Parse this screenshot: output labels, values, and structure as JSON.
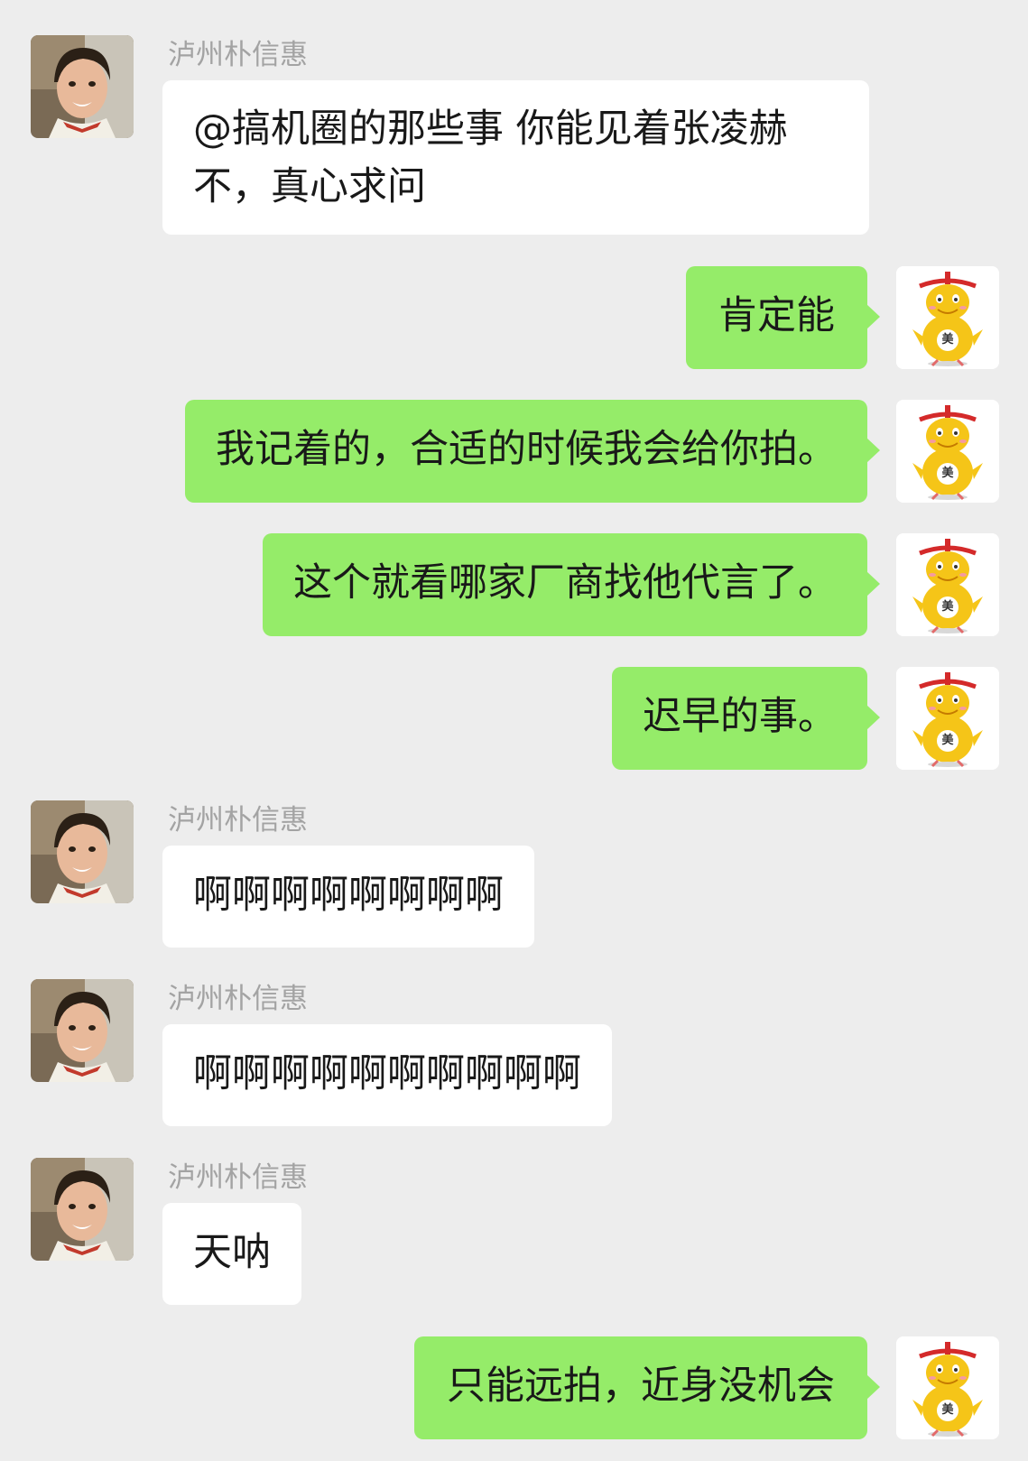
{
  "contact": {
    "name": "泸州朴信惠"
  },
  "messages": [
    {
      "from": "them",
      "sender": "泸州朴信惠",
      "text": "@搞机圈的那些事  你能见着张凌赫不，真心求问"
    },
    {
      "from": "me",
      "text": "肯定能"
    },
    {
      "from": "me",
      "text": "我记着的，合适的时候我会给你拍。"
    },
    {
      "from": "me",
      "text": "这个就看哪家厂商找他代言了。"
    },
    {
      "from": "me",
      "text": "迟早的事。"
    },
    {
      "from": "them",
      "sender": "泸州朴信惠",
      "text": "啊啊啊啊啊啊啊啊"
    },
    {
      "from": "them",
      "sender": "泸州朴信惠",
      "text": "啊啊啊啊啊啊啊啊啊啊"
    },
    {
      "from": "them",
      "sender": "泸州朴信惠",
      "text": "天呐"
    },
    {
      "from": "me",
      "text": "只能远拍，近身没机会"
    }
  ],
  "avatars": {
    "them_icon": "portrait-photo-icon",
    "me_icon": "yellow-mascot-icon",
    "me_badge": "美"
  },
  "colors": {
    "background": "#ededed",
    "incoming_bubble": "#ffffff",
    "outgoing_bubble": "#95ec69",
    "sender_name": "#a3a3a3",
    "text": "#191919"
  }
}
